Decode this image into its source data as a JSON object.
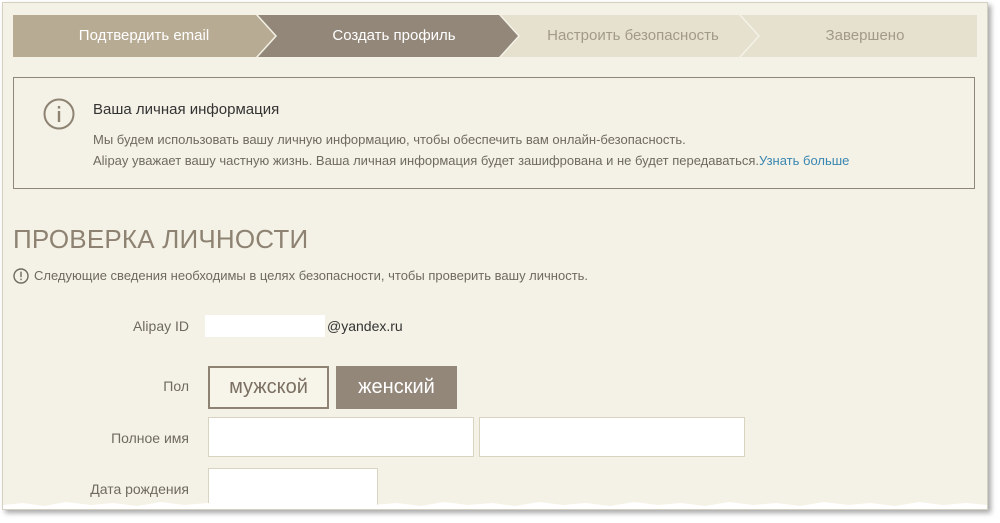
{
  "stepper": {
    "steps": [
      {
        "label": "Подтвердить email",
        "state": "completed"
      },
      {
        "label": "Создать профиль",
        "state": "active"
      },
      {
        "label": "Настроить безопасность",
        "state": "pending"
      },
      {
        "label": "Завершено",
        "state": "pending"
      }
    ],
    "colors": {
      "completed": "#b8ab94",
      "active": "#93877a",
      "pending": "#e6e1cf",
      "separator": "#f4f2e6"
    }
  },
  "info": {
    "icon": "info-icon",
    "title": "Ваша личная информация",
    "line1": "Мы будем использовать вашу личную информацию, чтобы обеспечить вам онлайн-безопасность.",
    "line2": "Alipay уважает вашу частную жизнь. Ваша личная информация будет зашифрована и не будет передаваться.",
    "link": "Узнать больше"
  },
  "section": {
    "title": "ПРОВЕРКА ЛИЧНОСТИ",
    "notice_icon": "exclamation-circle-icon",
    "notice": "Следующие сведения необходимы в целях безопасности, чтобы проверить вашу личность."
  },
  "form": {
    "alipay_label": "Alipay ID",
    "alipay_value": "",
    "alipay_domain": "@yandex.ru",
    "gender_label": "Пол",
    "gender_male": "мужской",
    "gender_female": "женский",
    "gender_selected": "женский",
    "name_label": "Полное имя",
    "first_name_value": "",
    "last_name_value": "",
    "birth_label": "Дата рождения",
    "birth_value": ""
  },
  "colors": {
    "background": "#f4f2e6",
    "accent": "#93877a",
    "title": "#8e8272",
    "link": "#3a87b1"
  }
}
